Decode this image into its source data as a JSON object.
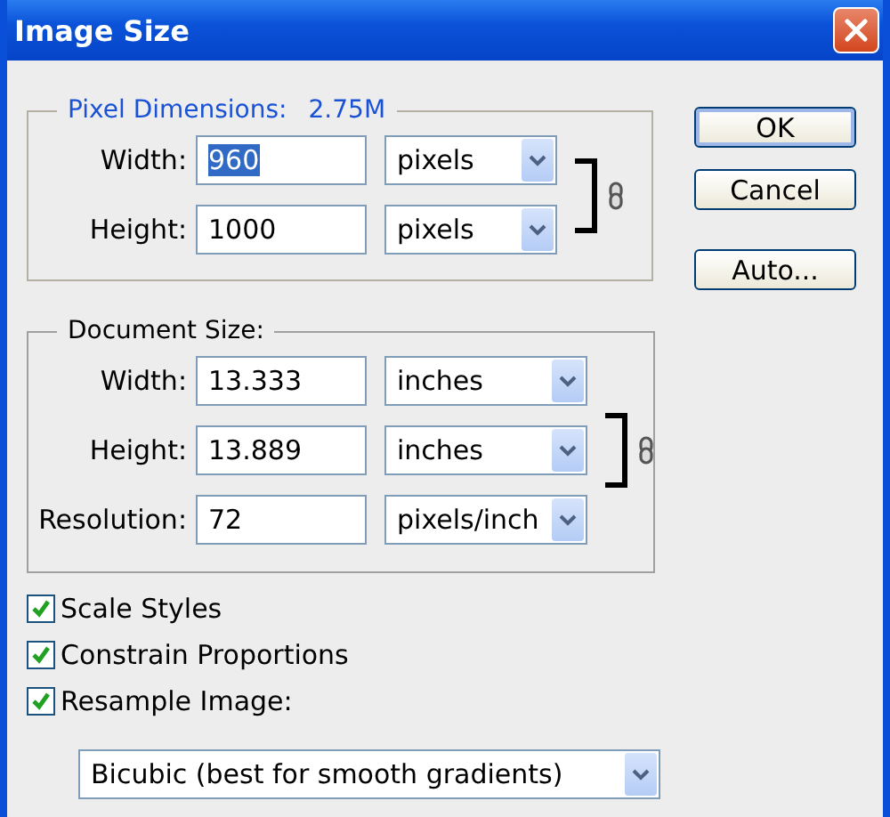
{
  "window": {
    "title": "Image Size"
  },
  "pixel_dimensions": {
    "title": "Pixel Dimensions:",
    "value": "2.75M",
    "constrained": true,
    "rows": [
      {
        "label": "Width:",
        "value": "960",
        "highlighted": true,
        "unit": "pixels"
      },
      {
        "label": "Height:",
        "value": "1000",
        "highlighted": false,
        "unit": "pixels"
      }
    ]
  },
  "document_size": {
    "title": "Document Size:",
    "constrained": true,
    "rows": [
      {
        "label": "Width:",
        "value": "13.333",
        "highlighted": false,
        "unit": "inches"
      },
      {
        "label": "Height:",
        "value": "13.889",
        "highlighted": false,
        "unit": "inches"
      },
      {
        "label": "Resolution:",
        "value": "72",
        "highlighted": false,
        "unit": "pixels/inch"
      }
    ]
  },
  "options": [
    {
      "label": "Scale Styles",
      "checked": true
    },
    {
      "label": "Constrain Proportions",
      "checked": true
    },
    {
      "label": "Resample Image:",
      "checked": true
    }
  ],
  "resample_method": "Bicubic (best for smooth gradients)",
  "buttons": [
    {
      "label": "OK",
      "default": true
    },
    {
      "label": "Cancel",
      "default": false
    },
    {
      "label": "Auto...",
      "default": false
    }
  ]
}
